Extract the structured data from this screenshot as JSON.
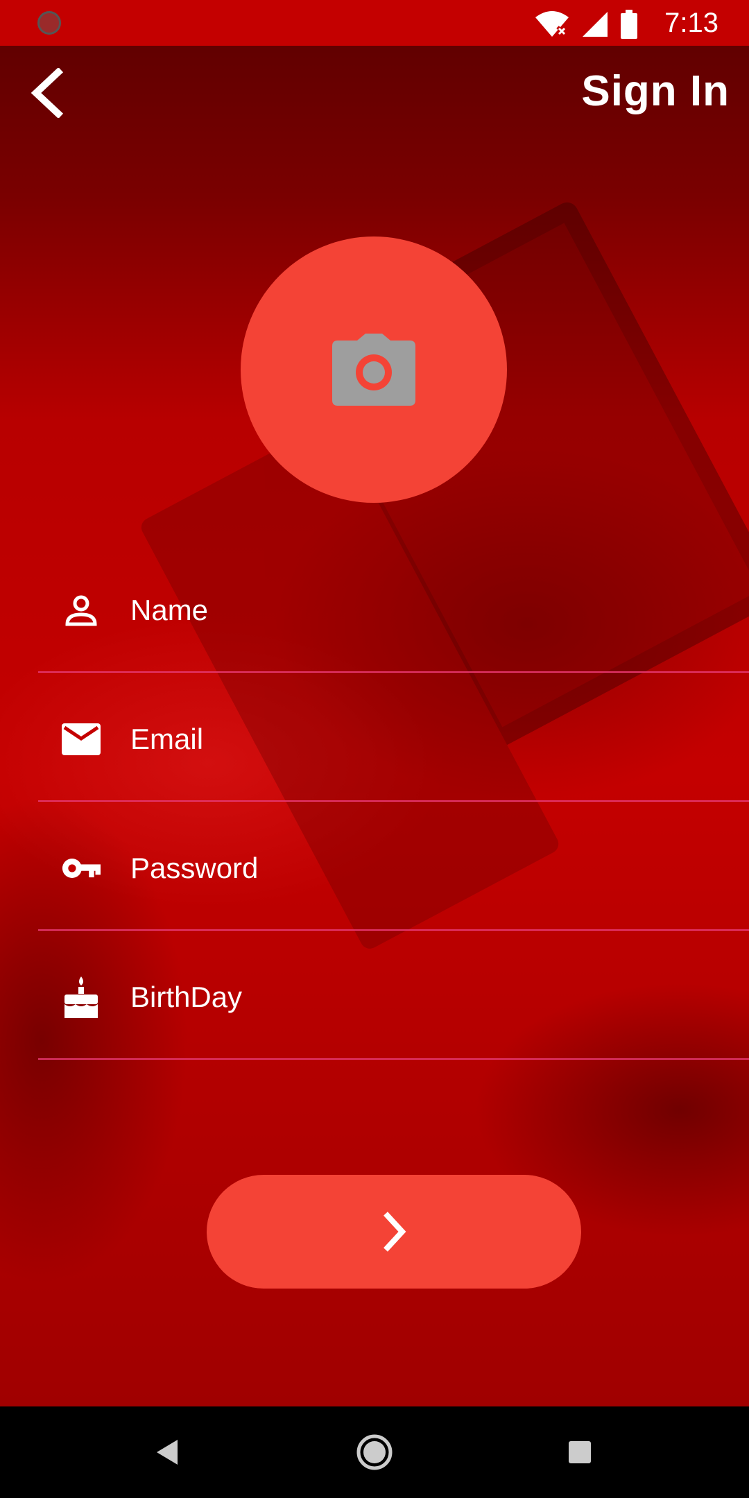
{
  "status_bar": {
    "time": "7:13",
    "icons": [
      "wifi-off-icon",
      "signal-icon",
      "battery-icon"
    ]
  },
  "app_bar": {
    "title": "Sign In",
    "back_icon": "chevron-left-icon"
  },
  "avatar": {
    "icon": "camera-icon"
  },
  "form": {
    "fields": [
      {
        "label": "Name",
        "icon": "person-icon"
      },
      {
        "label": "Email",
        "icon": "mail-icon"
      },
      {
        "label": "Password",
        "icon": "key-icon"
      },
      {
        "label": "BirthDay",
        "icon": "cake-icon"
      }
    ]
  },
  "next_button": {
    "icon": "chevron-right-icon"
  },
  "nav_bar": {
    "icons": [
      "back-triangle-icon",
      "home-circle-icon",
      "recents-square-icon"
    ]
  },
  "colors": {
    "accent": "#f44336",
    "underline": "#e3356b",
    "background": "#c40000",
    "camera_glyph": "#9e9e9e"
  }
}
